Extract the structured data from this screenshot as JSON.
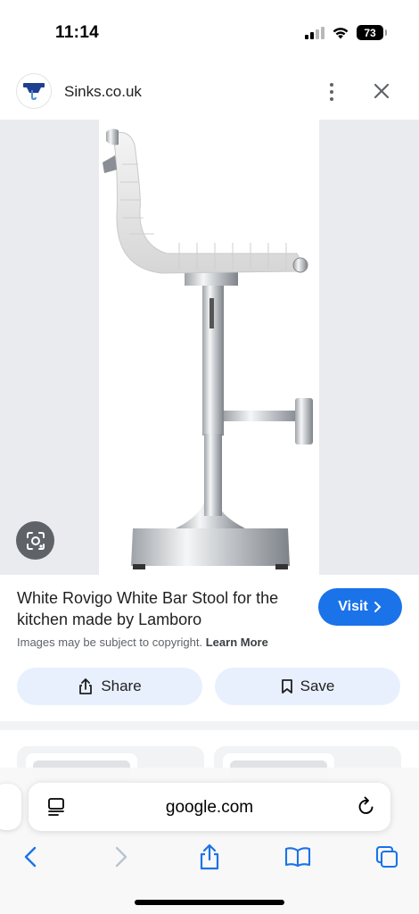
{
  "status_bar": {
    "time": "11:14",
    "battery": "73"
  },
  "site": {
    "name": "Sinks.co.uk"
  },
  "result": {
    "title": "White Rovigo White Bar Stool for the kitchen made by Lamboro",
    "visit_label": "Visit",
    "copyright_text": "Images may be subject to copyright.",
    "learn_more": "Learn More",
    "share_label": "Share",
    "save_label": "Save"
  },
  "browser": {
    "url": "google.com"
  },
  "colors": {
    "accent": "#1a73e8",
    "button_bg": "#e8f0fe",
    "image_bg": "#e9ebee"
  },
  "icons": [
    "cellular-signal-icon",
    "wifi-icon",
    "battery-icon",
    "more-vert-icon",
    "close-icon",
    "lens-icon",
    "share-icon",
    "bookmark-icon",
    "reader-icon",
    "reload-icon",
    "back-icon",
    "forward-icon",
    "safari-share-icon",
    "bookmarks-icon",
    "tabs-icon"
  ]
}
